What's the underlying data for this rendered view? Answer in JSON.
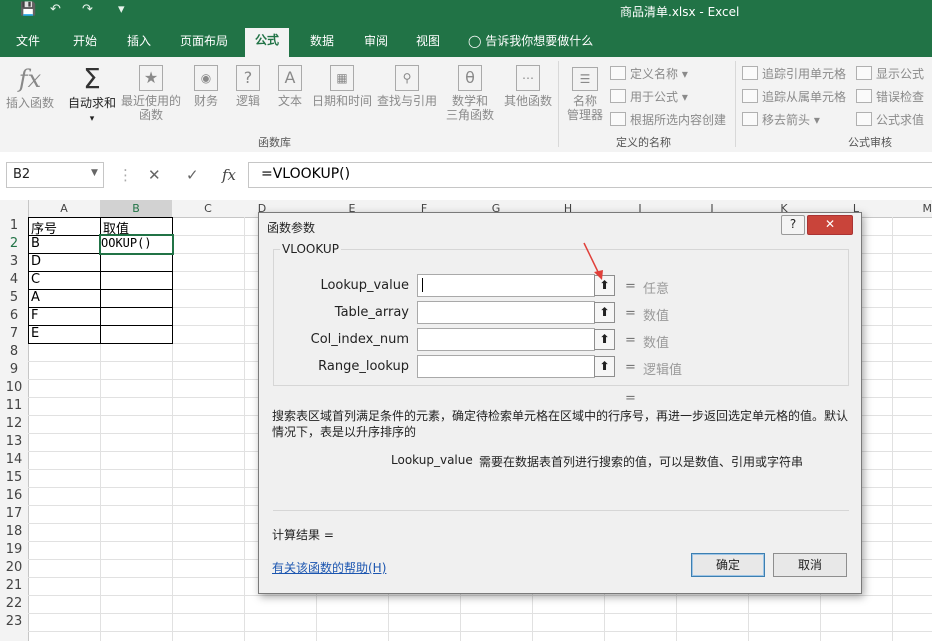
{
  "window": {
    "title": "商品清单.xlsx  -  Excel"
  },
  "tabs": [
    "文件",
    "开始",
    "插入",
    "页面布局",
    "公式",
    "数据",
    "审阅",
    "视图"
  ],
  "active_tab": "公式",
  "tell_me": "告诉我你想要做什么",
  "ribbon": {
    "insert_function": "插入函数",
    "autosum": "自动求和",
    "recent_l1": "最近使用的",
    "recent_l2": "函数",
    "financial": "财务",
    "logical": "逻辑",
    "text": "文本",
    "datetime": "日期和时间",
    "lookup": "查找与引用",
    "math_l1": "数学和",
    "math_l2": "三角函数",
    "other": "其他函数",
    "library_group": "函数库",
    "name_manager_l1": "名称",
    "name_manager_l2": "管理器",
    "define_name": "定义名称",
    "use_in_formula": "用于公式",
    "create_from_selection": "根据所选内容创建",
    "names_group": "定义的名称",
    "trace_precedents": "追踪引用单元格",
    "trace_dependents": "追踪从属单元格",
    "remove_arrows": "移去箭头",
    "show_formulas": "显示公式",
    "error_checking": "错误检查",
    "evaluate_formula": "公式求值",
    "audit_group": "公式审核"
  },
  "formula_bar": {
    "name_box": "B2",
    "formula": "=VLOOKUP()"
  },
  "columns": [
    "A",
    "B",
    "C",
    "D",
    "E",
    "F",
    "G",
    "H",
    "I",
    "J",
    "K",
    "L",
    "M"
  ],
  "rows": [
    "1",
    "2",
    "3",
    "4",
    "5",
    "6",
    "7",
    "8",
    "9",
    "10",
    "11",
    "12",
    "13",
    "14",
    "15",
    "16",
    "17",
    "18",
    "19",
    "20",
    "21",
    "22",
    "23"
  ],
  "cells": {
    "A1": "序号",
    "B1": "取值",
    "A2": "B",
    "B2": "OOKUP()",
    "A3": "D",
    "A4": "C",
    "A5": "A",
    "A6": "F",
    "A7": "E"
  },
  "dialog": {
    "title": "函数参数",
    "help_btn": "?",
    "close_btn": "✕",
    "function_name": "VLOOKUP",
    "args": [
      {
        "label": "Lookup_value",
        "value": "任意"
      },
      {
        "label": "Table_array",
        "value": "数值"
      },
      {
        "label": "Col_index_num",
        "value": "数值"
      },
      {
        "label": "Range_lookup",
        "value": "逻辑值"
      }
    ],
    "equals": "=",
    "result_equals": "=",
    "description": "搜索表区域首列满足条件的元素，确定待检索单元格在区域中的行序号，再进一步返回选定单元格的值。默认情况下，表是以升序排序的",
    "arg_help_name": "Lookup_value",
    "arg_help_text": "需要在数据表首列进行搜索的值，可以是数值、引用或字符串",
    "calc_result": "计算结果 =",
    "help_link": "有关该函数的帮助(H)",
    "ok": "确定",
    "cancel": "取消"
  },
  "colors": {
    "excel_green": "#217346",
    "accent_red": "#e0403a"
  }
}
